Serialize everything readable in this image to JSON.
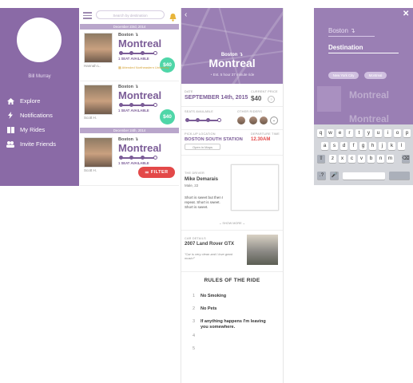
{
  "menu": {
    "user_name": "Bill Murray",
    "items": [
      {
        "label": "Explore",
        "icon": "home-icon"
      },
      {
        "label": "Notifications",
        "icon": "bolt-icon"
      },
      {
        "label": "My Rides",
        "icon": "book-icon"
      },
      {
        "label": "Invite Friends",
        "icon": "users-icon"
      }
    ],
    "bg_color": "#8a6aa6"
  },
  "list": {
    "search_placeholder": "Search by destination",
    "dates": [
      "December 23rd, 2014",
      "December 24th, 2014"
    ],
    "rides": [
      {
        "driver": "Hannah L.",
        "from": "Boston",
        "to": "Montreal",
        "seats": "1 SEAT AVAILABLE",
        "price": "$40",
        "note": "Attended Northeastern University"
      },
      {
        "driver": "Scott H.",
        "from": "Boston",
        "to": "Montreal",
        "seats": "1 SEAT AVAILABLE",
        "price": "$40",
        "note": ""
      },
      {
        "driver": "Scott H.",
        "from": "Boston",
        "to": "Montreal",
        "seats": "1 SEAT AVAILABLE",
        "price": "",
        "note": ""
      }
    ],
    "filter_label": "FILTER"
  },
  "detail": {
    "from": "Boston",
    "to": "Montreal",
    "estimate": "Est. 5 hour 37 minute ride",
    "date_label": "DATE",
    "date": "SEPTEMBER 14th, 2015",
    "price_label": "CURRENT PRICE",
    "price": "$40",
    "seats_label": "SEATS AVAILABLE",
    "riders_label": "OTHER RIDERS",
    "pickup_label": "PICK-UP LOCATION",
    "pickup": "BOSTON SOUTH STATION",
    "departure_label": "DEPARTURE TIME",
    "departure": "12.30AM",
    "open_maps": "Open in Maps",
    "driver_label": "THE DRIVER",
    "driver_name": "Mike Demarais",
    "driver_info": "Male, 22",
    "driver_bio": "Short is sweet but then I repeat. Short is sweet. Short is sweet.",
    "show_more": "SHOW MORE",
    "car_label": "CAR DETAILS",
    "car": "2007 Land Rover GTX",
    "car_quote": "\"Car is very clean and I love great music!\"",
    "rules_title": "RULES OF THE RIDE",
    "rules": [
      {
        "n": "1",
        "text": "No Smoking"
      },
      {
        "n": "2",
        "text": "No Pets"
      },
      {
        "n": "3",
        "text": "If anything happens I'm leaving you somewhere."
      },
      {
        "n": "4",
        "text": ""
      },
      {
        "n": "5",
        "text": ""
      }
    ]
  },
  "search": {
    "origin": "Boston",
    "destination_placeholder": "Destination",
    "chips": [
      "New York City",
      "Montreal"
    ],
    "ghost_to": "Montreal",
    "keyboard_rows": [
      [
        "q",
        "w",
        "e",
        "r",
        "t",
        "y",
        "u",
        "i",
        "o",
        "p"
      ],
      [
        "a",
        "s",
        "d",
        "f",
        "g",
        "h",
        "j",
        "k",
        "l"
      ],
      [
        "z",
        "x",
        "c",
        "v",
        "b",
        "n",
        "m"
      ]
    ]
  },
  "colors": {
    "purple": "#7b5c97",
    "light_purple": "#9a7fb4",
    "green_price": "#4fd6a8",
    "red_filter": "#e34949",
    "orange_time": "#e34949"
  }
}
